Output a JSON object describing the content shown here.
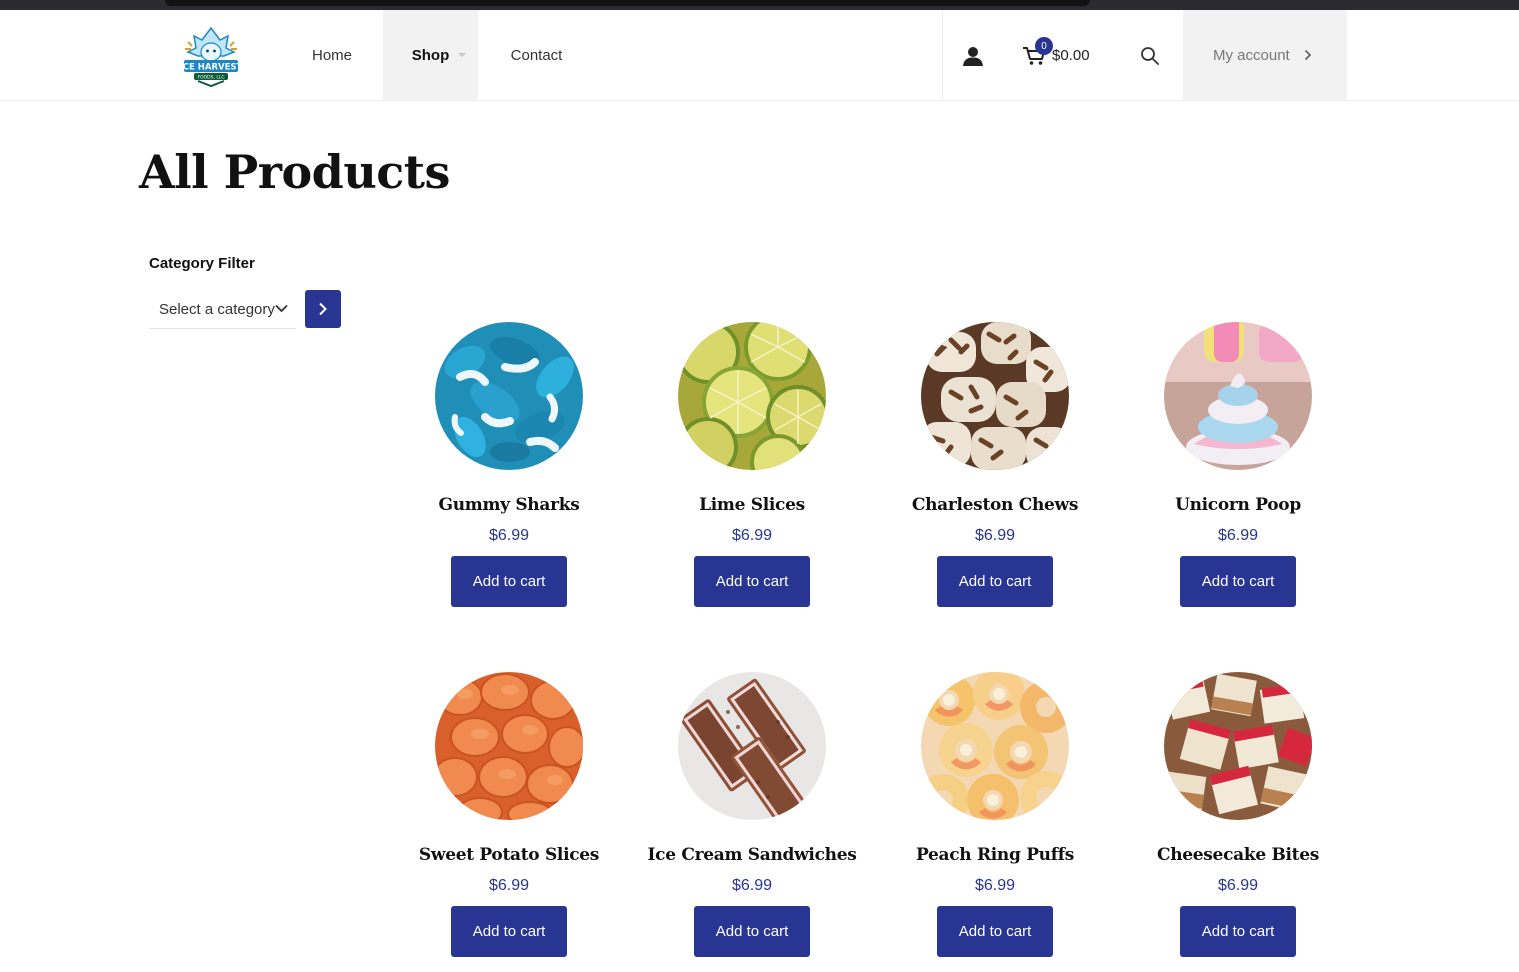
{
  "header": {
    "logo_text": "ICE HARVEST",
    "logo_subtext": "FOODS, LLC",
    "nav": [
      {
        "label": "Home"
      },
      {
        "label": "Shop"
      },
      {
        "label": "Contact"
      }
    ],
    "cart": {
      "count": "0",
      "total": "$0.00"
    },
    "account_label": "My account"
  },
  "page": {
    "title": "All Products"
  },
  "filter": {
    "title": "Category Filter",
    "select_value": "Select a category"
  },
  "colors": {
    "accent": "#283593"
  },
  "products": [
    {
      "name": "Gummy Sharks",
      "price": "$6.99",
      "button": "Add to cart"
    },
    {
      "name": "Lime Slices",
      "price": "$6.99",
      "button": "Add to cart"
    },
    {
      "name": "Charleston Chews",
      "price": "$6.99",
      "button": "Add to cart"
    },
    {
      "name": "Unicorn Poop",
      "price": "$6.99",
      "button": "Add to cart"
    },
    {
      "name": "Sweet Potato Slices",
      "price": "$6.99",
      "button": "Add to cart"
    },
    {
      "name": "Ice Cream Sandwiches",
      "price": "$6.99",
      "button": "Add to cart"
    },
    {
      "name": "Peach Ring Puffs",
      "price": "$6.99",
      "button": "Add to cart"
    },
    {
      "name": "Cheesecake Bites",
      "price": "$6.99",
      "button": "Add to cart"
    }
  ]
}
